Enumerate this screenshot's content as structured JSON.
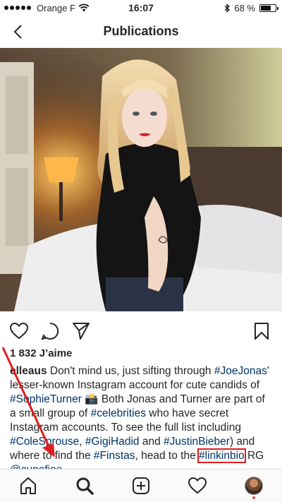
{
  "status_bar": {
    "carrier": "Orange F",
    "time": "16:07",
    "battery": "68 %",
    "battery_level": 0.68
  },
  "nav": {
    "title": "Publications",
    "back_icon": "chevron-left-icon"
  },
  "post": {
    "likes": "1 832 J’aime",
    "caption": {
      "username": "elleaus",
      "t1": " Don't mind us, just sifting through ",
      "tag1": "#JoeJonas",
      "t2": "' lesser-known Instagram account for cute candids of ",
      "tag2": "#SophieTurner",
      "t3": " 📸 Both Jonas and Turner are part of a small group of ",
      "tag3": "#celebrities",
      "t4": " who have secret Instagram accounts. To see the full list including ",
      "tag4": "#ColeSprouse",
      "t5": ", ",
      "tag5": "#GigiHadid",
      "t6": " and ",
      "tag6": "#JustinBieber",
      "t7": ") and where to find the ",
      "tag7": "#Finstas",
      "t8": ", head to the ",
      "tag8": "#linkinbio",
      "t9": " RG ",
      "mention": "@cupofjoe"
    }
  },
  "actions": [
    "heart-icon",
    "comment-icon",
    "share-icon",
    "bookmark-icon"
  ],
  "tabs": [
    "home-icon",
    "search-icon",
    "add-post-icon",
    "activity-heart-icon",
    "profile-avatar"
  ],
  "colors": {
    "hashtag": "#003569",
    "annotation": "#e01e1e",
    "notification": "#ed4956"
  }
}
